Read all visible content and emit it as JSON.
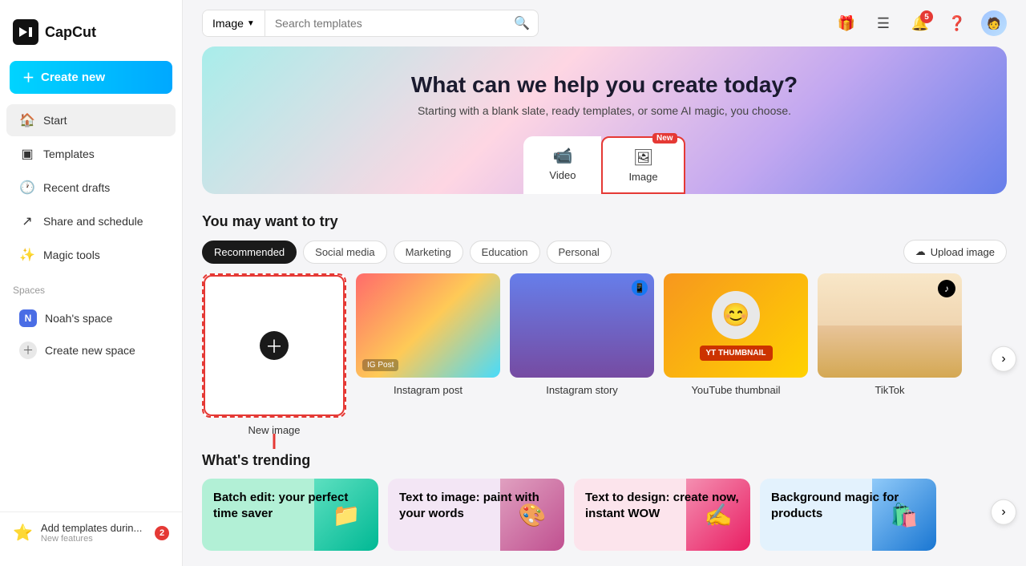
{
  "app": {
    "name": "CapCut"
  },
  "sidebar": {
    "create_new_label": "Create new",
    "nav_items": [
      {
        "id": "start",
        "label": "Start",
        "icon": "🏠",
        "active": true
      },
      {
        "id": "templates",
        "label": "Templates",
        "icon": "▣"
      },
      {
        "id": "recent-drafts",
        "label": "Recent drafts",
        "icon": "🕐"
      },
      {
        "id": "share-schedule",
        "label": "Share and schedule",
        "icon": "↗"
      },
      {
        "id": "magic-tools",
        "label": "Magic tools",
        "icon": "✨"
      }
    ],
    "spaces_label": "Spaces",
    "spaces": [
      {
        "id": "noah",
        "label": "Noah's space",
        "initial": "N"
      },
      {
        "id": "create-space",
        "label": "Create new space",
        "type": "add"
      }
    ],
    "footer": {
      "icon": "⭐",
      "text": "Add templates durin...",
      "subtext": "New features",
      "badge": "2"
    }
  },
  "topbar": {
    "search_dropdown_label": "Image",
    "search_placeholder": "Search templates",
    "icons": {
      "gift": "🎁",
      "menu": "☰",
      "bell": "🔔",
      "bell_badge": "5",
      "help": "❓"
    }
  },
  "hero": {
    "title": "What can we help you create today?",
    "subtitle": "Starting with a blank slate, ready templates, or some AI magic, you choose.",
    "tabs": [
      {
        "id": "video",
        "label": "Video",
        "active": false
      },
      {
        "id": "image",
        "label": "Image",
        "active": true,
        "badge": "New"
      }
    ]
  },
  "you_may_want": {
    "title": "You may want to try",
    "filters": [
      {
        "id": "recommended",
        "label": "Recommended",
        "active": true
      },
      {
        "id": "social-media",
        "label": "Social media"
      },
      {
        "id": "marketing",
        "label": "Marketing"
      },
      {
        "id": "education",
        "label": "Education"
      },
      {
        "id": "personal",
        "label": "Personal"
      }
    ],
    "upload_label": "Upload image",
    "cards": [
      {
        "id": "new-image",
        "label": "New image",
        "type": "new"
      },
      {
        "id": "instagram-post",
        "label": "Instagram post",
        "type": "thumb"
      },
      {
        "id": "instagram-story",
        "label": "Instagram story",
        "type": "thumb"
      },
      {
        "id": "youtube-thumbnail",
        "label": "YouTube thumbnail",
        "type": "thumb"
      },
      {
        "id": "tiktok",
        "label": "TikTok",
        "type": "thumb"
      }
    ]
  },
  "trending": {
    "title": "What's trending",
    "cards": [
      {
        "id": "batch-edit",
        "text": "Batch edit: your perfect time saver",
        "color": "#b2f0d6"
      },
      {
        "id": "text-to-image",
        "text": "Text to image: paint with your words",
        "color": "#f3e6f5"
      },
      {
        "id": "text-to-design",
        "text": "Text to design: create now, instant WOW",
        "color": "#fce4ec"
      },
      {
        "id": "background-magic",
        "text": "Background magic for products",
        "color": "#e3f2fd"
      }
    ]
  }
}
